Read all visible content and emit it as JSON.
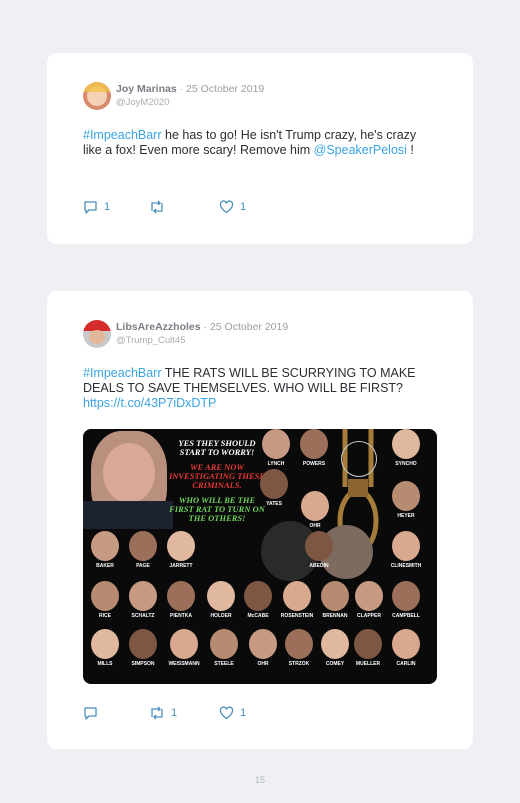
{
  "posts": [
    {
      "author": "Joy Marinas",
      "date": "· 25 October 2019",
      "handle": "@JoyM2020",
      "hashtag": "#ImpeachBarr",
      "text": " he has to go! He isn't Trump crazy, he's crazy like a fox! Even more scary! Remove him ",
      "mention": "@SpeakerPelosi",
      "text_end": " !",
      "reply_count": "1",
      "retweet_count": "",
      "like_count": "1"
    },
    {
      "author": "LibsAreAzzholes",
      "date": "· 25 October 2019",
      "handle": "@Trump_Cult45",
      "hashtag": "#ImpeachBarr",
      "text": " THE RATS WILL BE SCURRYING TO MAKE DEALS TO SAVE THEMSELVES. WHO WILL BE FIRST? ",
      "link": "https://t.co/43P7iDxDTP",
      "reply_count": "",
      "retweet_count": "1",
      "like_count": "1",
      "image": {
        "headline_1": "YES THEY SHOULD START TO WORRY!",
        "headline_2": "WE ARE NOW INVESTIGATING THESE CRIMINALS.",
        "headline_3": "WHO WILL BE THE FIRST RAT TO TURN ON THE OTHERS!",
        "names": [
          "LYNCH",
          "POWERS",
          "SYNCHO",
          "YATES",
          "OHR",
          "HEYER",
          "BAKER",
          "PAGE",
          "JARRETT",
          "ABEDIN",
          "CLINESMITH",
          "RICE",
          "SCHALTZ",
          "PIENTKA",
          "HOLDER",
          "McCABE",
          "ROSENSTEIN",
          "BRENNAN",
          "CLAPPER",
          "CAMPBELL",
          "MILLS",
          "SIMPSON",
          "WEISSMANN",
          "STEELE",
          "OHR",
          "STRZOK",
          "COMEY",
          "MUELLER",
          "CARLIN"
        ]
      }
    }
  ],
  "page_number": "15",
  "colors": {
    "accent": "#3aa3e3",
    "background": "#eef0f4",
    "card": "#ffffff"
  }
}
